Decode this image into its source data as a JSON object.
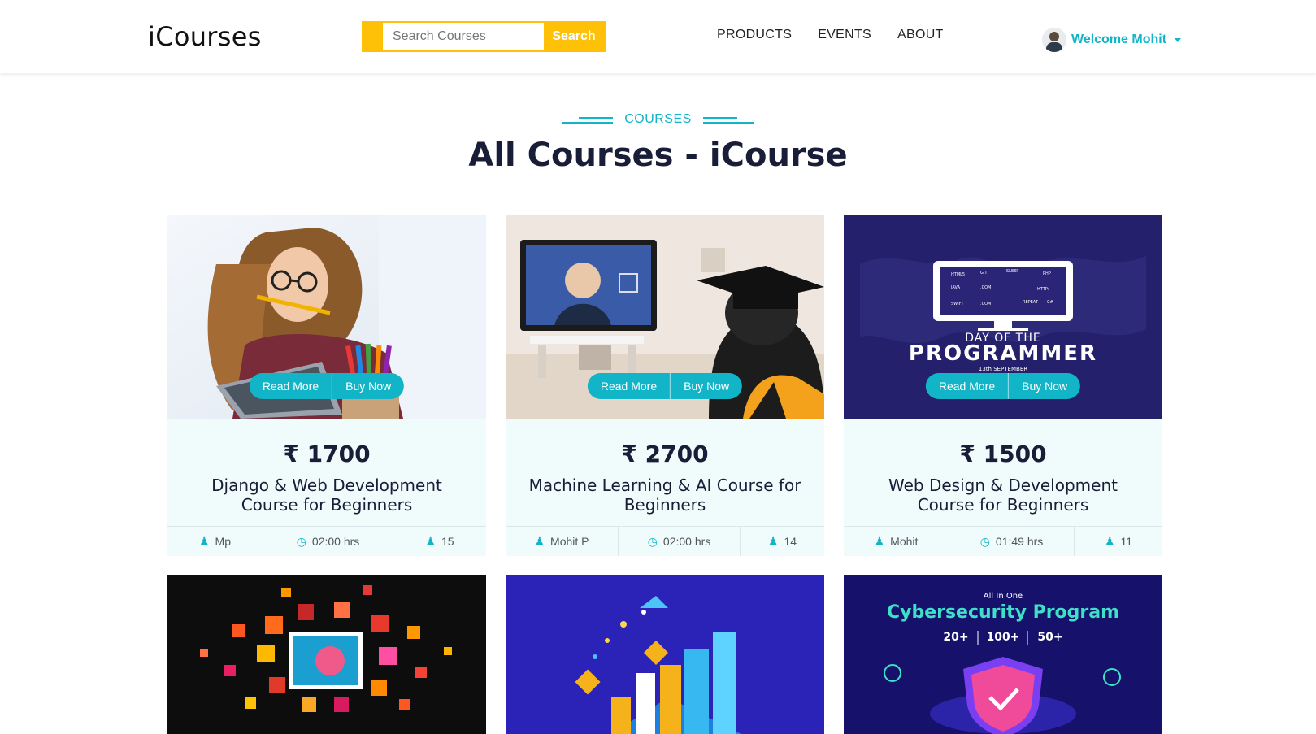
{
  "navbar": {
    "brand": "iCourses",
    "search_placeholder": "Search Courses",
    "search_button": "Search",
    "links": [
      "PRODUCTS",
      "EVENTS",
      "ABOUT"
    ],
    "user_label": "Welcome Mohit"
  },
  "section": {
    "eyebrow": "COURSES",
    "title": "All Courses - iCourse"
  },
  "card_buttons": {
    "read_more": "Read More",
    "buy_now": "Buy Now"
  },
  "courses": [
    {
      "price": "₹ 1700",
      "name": "Django & Web Development Course for Beginners",
      "author": "Mp",
      "duration": "02:00 hrs",
      "students": "15"
    },
    {
      "price": "₹ 2700",
      "name": "Machine Learning & AI Course for Beginners",
      "author": "Mohit P",
      "duration": "02:00 hrs",
      "students": "14"
    },
    {
      "price": "₹ 1500",
      "name": "Web Design & Development Course for Beginners",
      "author": "Mohit",
      "duration": "01:49 hrs",
      "students": "11"
    }
  ],
  "images": {
    "programmer": {
      "line1": "DAY OF THE",
      "line2": "PROGRAMMER",
      "date": "13th SEPTEMBER"
    },
    "cyber": {
      "tag": "All In One",
      "title": "Cybersecurity Program",
      "stats": [
        "20+",
        "100+",
        "50+"
      ]
    }
  },
  "colors": {
    "accent": "#11b5c7",
    "search": "#ffc107",
    "dark": "#181d38"
  }
}
